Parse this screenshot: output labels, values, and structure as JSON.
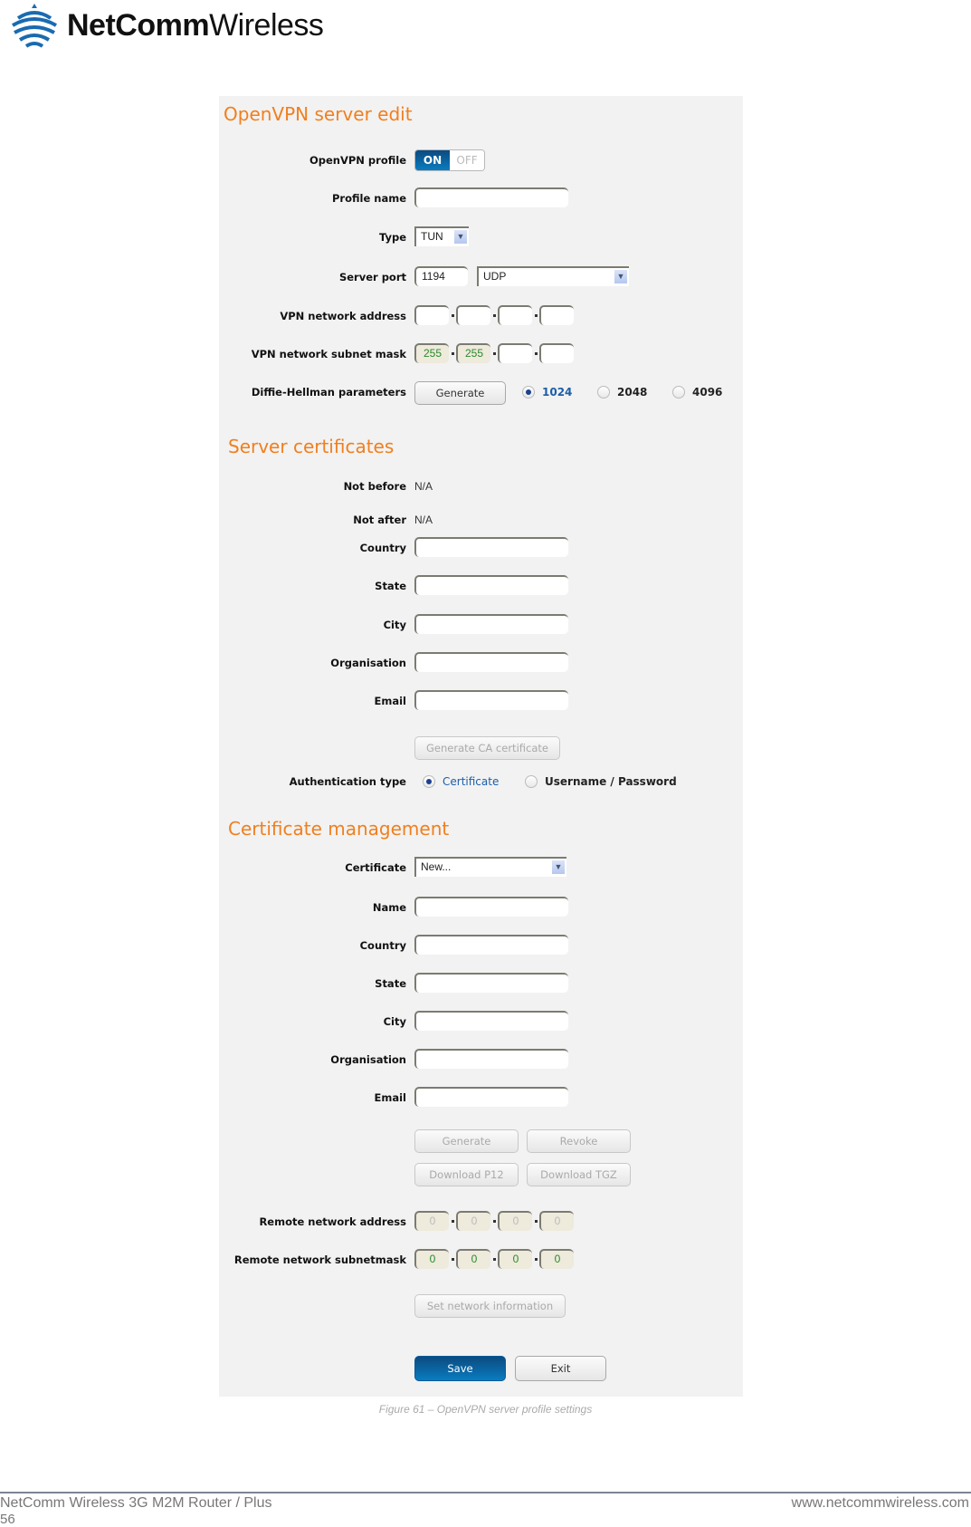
{
  "brand": {
    "name_bold": "NetComm",
    "name_light": "Wireless",
    "logo_icon": "wifi-signal-icon"
  },
  "form": {
    "title": "OpenVPN server edit",
    "openvpn_profile": {
      "label": "OpenVPN profile",
      "on": "ON",
      "off": "OFF",
      "state": "ON"
    },
    "profile_name": {
      "label": "Profile name",
      "value": ""
    },
    "type": {
      "label": "Type",
      "value": "TUN"
    },
    "server_port": {
      "label": "Server port",
      "port": "1194",
      "protocol": "UDP"
    },
    "vpn_network_address": {
      "label": "VPN network address",
      "octets": [
        "",
        "",
        "",
        ""
      ]
    },
    "vpn_subnet_mask": {
      "label": "VPN network subnet mask",
      "octets": [
        "255",
        "255",
        "",
        ""
      ]
    },
    "dh": {
      "label": "Diffie-Hellman parameters",
      "generate": "Generate",
      "options": [
        "1024",
        "2048",
        "4096"
      ],
      "selected": "1024"
    }
  },
  "server_certs": {
    "title": "Server certificates",
    "not_before": {
      "label": "Not before",
      "value": "N/A"
    },
    "not_after": {
      "label": "Not after",
      "value": "N/A"
    },
    "fields": [
      {
        "label": "Country",
        "value": ""
      },
      {
        "label": "State",
        "value": ""
      },
      {
        "label": "City",
        "value": ""
      },
      {
        "label": "Organisation",
        "value": ""
      },
      {
        "label": "Email",
        "value": ""
      }
    ],
    "generate_ca": "Generate CA certificate",
    "auth": {
      "label": "Authentication type",
      "options": [
        "Certificate",
        "Username / Password"
      ],
      "selected": "Certificate"
    }
  },
  "cert_mgmt": {
    "title": "Certificate management",
    "certificate": {
      "label": "Certificate",
      "value": "New..."
    },
    "fields": [
      {
        "label": "Name",
        "value": ""
      },
      {
        "label": "Country",
        "value": ""
      },
      {
        "label": "State",
        "value": ""
      },
      {
        "label": "City",
        "value": ""
      },
      {
        "label": "Organisation",
        "value": ""
      },
      {
        "label": "Email",
        "value": ""
      }
    ],
    "buttons": {
      "generate": "Generate",
      "revoke": "Revoke",
      "download_p12": "Download P12",
      "download_tgz": "Download TGZ"
    },
    "remote_address": {
      "label": "Remote network address",
      "octets": [
        "0",
        "0",
        "0",
        "0"
      ]
    },
    "remote_mask": {
      "label": "Remote network subnetmask",
      "octets": [
        "0",
        "0",
        "0",
        "0"
      ]
    },
    "set_network": "Set network information"
  },
  "actions": {
    "save": "Save",
    "exit": "Exit"
  },
  "caption": "Figure 61 – OpenVPN server profile settings",
  "footer": {
    "product": "NetComm Wireless 3G M2M Router / Plus",
    "url": "www.netcommwireless.com",
    "page": "56"
  },
  "colors": {
    "accent": "#f07f1e",
    "primary": "#0a6aa8"
  }
}
